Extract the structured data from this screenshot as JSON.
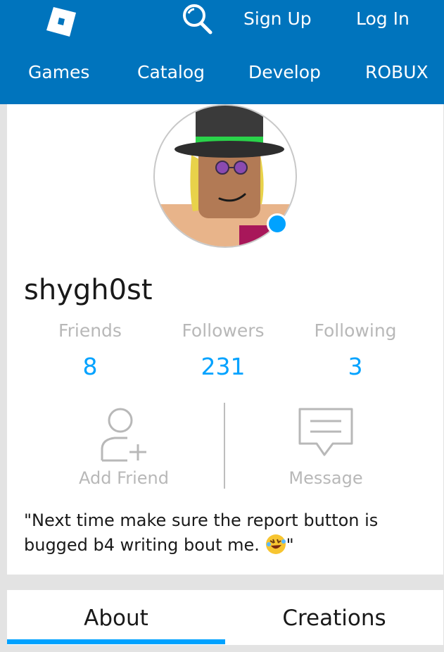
{
  "header": {
    "signup_label": "Sign Up",
    "login_label": "Log In",
    "nav": [
      "Games",
      "Catalog",
      "Develop",
      "ROBUX"
    ],
    "brand_color": "#0074bd"
  },
  "profile": {
    "username": "shygh0st",
    "online_status_color": "#00a2ff",
    "stats": [
      {
        "label": "Friends",
        "value": "8"
      },
      {
        "label": "Followers",
        "value": "231"
      },
      {
        "label": "Following",
        "value": "3"
      }
    ],
    "actions": {
      "add_friend": "Add Friend",
      "message": "Message"
    },
    "bio": "\"Next time make sure the report button is bugged b4 writing bout me.",
    "bio_end": "\""
  },
  "tabs": {
    "about": "About",
    "creations": "Creations",
    "active": "About"
  },
  "icons": [
    "roblox-logo",
    "search-icon",
    "add-friend-icon",
    "message-icon",
    "rofl-emoji"
  ]
}
